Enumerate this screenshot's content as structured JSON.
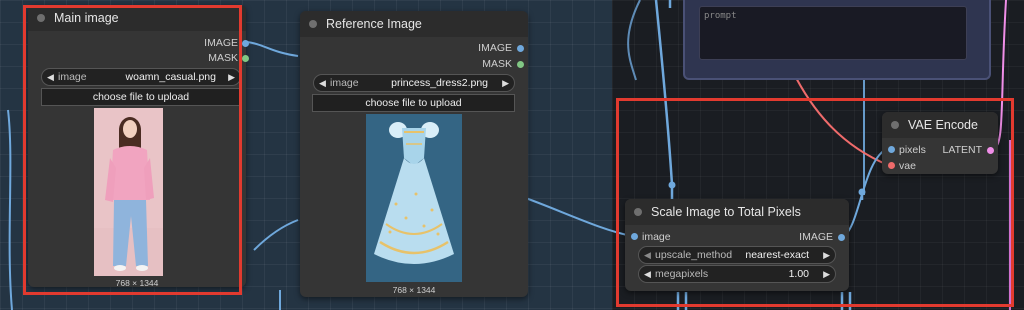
{
  "nodes": {
    "main_image": {
      "title": "Main image",
      "outputs": [
        "IMAGE",
        "MASK"
      ],
      "widget_label": "image",
      "widget_value": "woamn_casual.png",
      "upload_label": "choose file to upload",
      "dims": "768 × 1344"
    },
    "reference_image": {
      "title": "Reference Image",
      "outputs": [
        "IMAGE",
        "MASK"
      ],
      "widget_label": "image",
      "widget_value": "princess_dress2.png",
      "upload_label": "choose file to upload",
      "dims": "768 × 1344"
    },
    "scale_image": {
      "title": "Scale Image to Total Pixels",
      "input": "image",
      "output": "IMAGE",
      "upscale_label": "upscale_method",
      "upscale_value": "nearest-exact",
      "megapixels_label": "megapixels",
      "megapixels_value": "1.00"
    },
    "vae_encode": {
      "title": "VAE Encode",
      "inputs": [
        "pixels",
        "vae"
      ],
      "output": "LATENT"
    },
    "prompt_node": {
      "placeholder": "prompt"
    }
  },
  "colors": {
    "image_port": "#6fa8dc",
    "mask_port": "#81c784",
    "vae_port": "#ef6b6b",
    "latent_port": "#f08ee8",
    "highlight": "#e23a2f"
  }
}
